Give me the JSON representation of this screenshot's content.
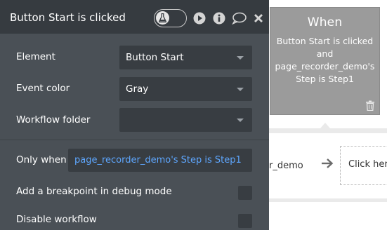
{
  "panel": {
    "title": "Button Start is clicked",
    "fields": {
      "element_label": "Element",
      "element_value": "Button Start",
      "event_color_label": "Event color",
      "event_color_value": "Gray",
      "workflow_folder_label": "Workflow folder",
      "workflow_folder_value": ""
    },
    "only_when_label": "Only when",
    "only_when_expression": "page_recorder_demo's Step is Step1",
    "breakpoint_label": "Add a breakpoint in debug mode",
    "disable_label": "Disable workflow"
  },
  "canvas": {
    "event_card": {
      "heading": "When",
      "line1": "Button Start is clicked",
      "line2": "and",
      "line3": "page_recorder_demo's",
      "line4": "Step is Step1"
    },
    "action_text": "r_demo",
    "action_box_text": "Click her"
  },
  "colors": {
    "panel_bg": "#4a5056",
    "header_bg": "#363b40",
    "field_bg": "#383d42",
    "expression_text": "#5ea7ff",
    "event_card_bg": "#9b9b9b"
  },
  "icons": [
    "flask-icon",
    "play-icon",
    "info-icon",
    "comment-icon",
    "close-icon",
    "trash-icon",
    "arrow-right-icon"
  ]
}
